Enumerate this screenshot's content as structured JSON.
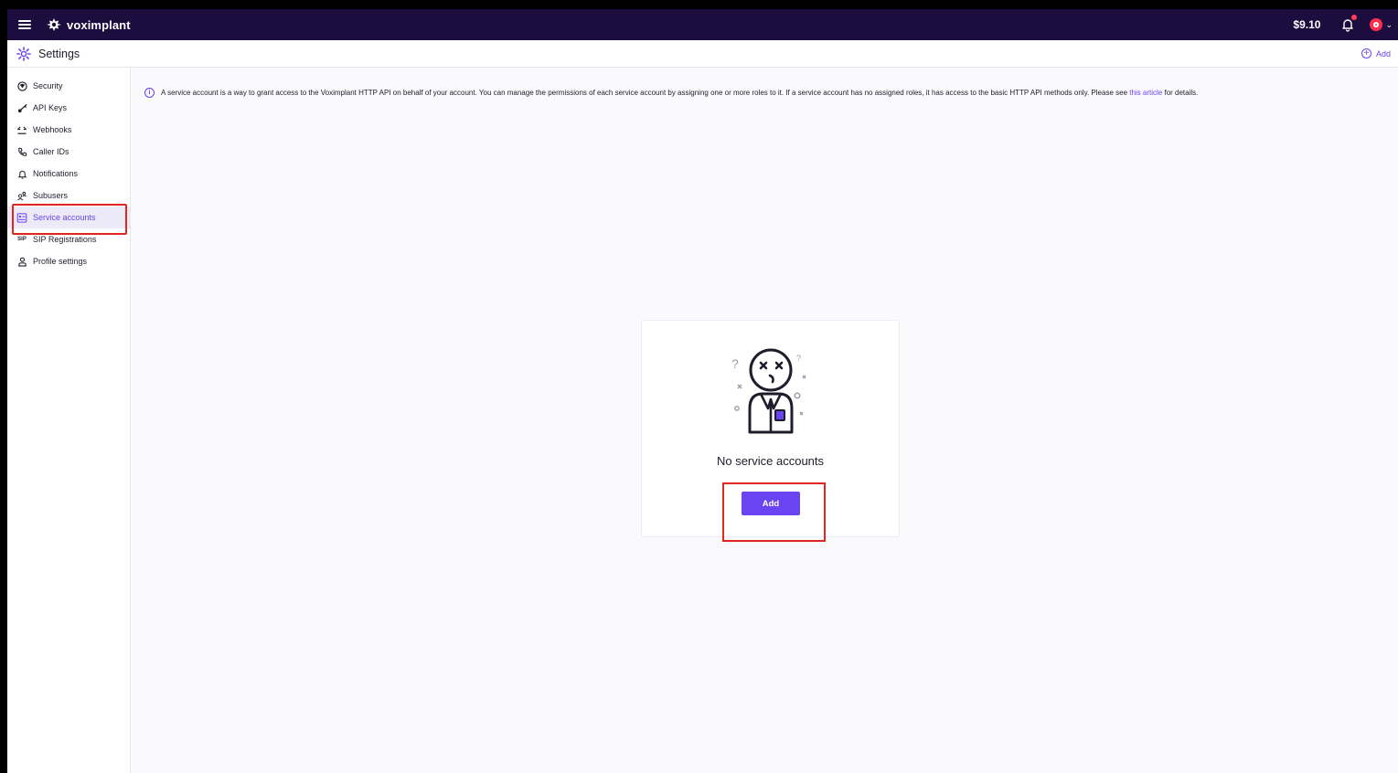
{
  "topbar": {
    "logo_text": "voximplant",
    "balance": "$9.10",
    "icons": [
      "menu-icon",
      "voximplant-logo-icon",
      "bell-icon",
      "avatar-icon",
      "chevron-down-icon"
    ],
    "accent_color": "#1c0d3e",
    "notification_dot_color": "#ff3c5a"
  },
  "subheader": {
    "title": "Settings",
    "add_label": "Add",
    "icon": "gear-icon"
  },
  "sidebar": {
    "items": [
      {
        "label": "Security",
        "icon": "shield-icon"
      },
      {
        "label": "API Keys",
        "icon": "key-icon"
      },
      {
        "label": "Webhooks",
        "icon": "webhook-icon"
      },
      {
        "label": "Caller IDs",
        "icon": "phone-icon"
      },
      {
        "label": "Notifications",
        "icon": "bell-icon"
      },
      {
        "label": "Subusers",
        "icon": "users-icon"
      },
      {
        "label": "Service accounts",
        "icon": "service-account-icon",
        "active": true
      },
      {
        "label": "SIP Registrations",
        "icon": "sip-icon",
        "icon_text": "SIP"
      },
      {
        "label": "Profile settings",
        "icon": "person-icon"
      }
    ],
    "active_color": "#6a43f2"
  },
  "main": {
    "info_text": "A service account is a way to grant access to the Voximplant HTTP API on behalf of your account. You can manage the permissions of each service account by assigning one or more roles to it. If a service account has no assigned roles, it has access to the basic HTTP API methods only. Please see ",
    "info_link": "this article",
    "info_suffix": " for details.",
    "empty_state": {
      "message": "No service accounts",
      "button_label": "Add",
      "illustration": "confused-person-illustration"
    }
  },
  "colors": {
    "primary": "#6a43f2",
    "highlight_box": "#e0261f"
  }
}
